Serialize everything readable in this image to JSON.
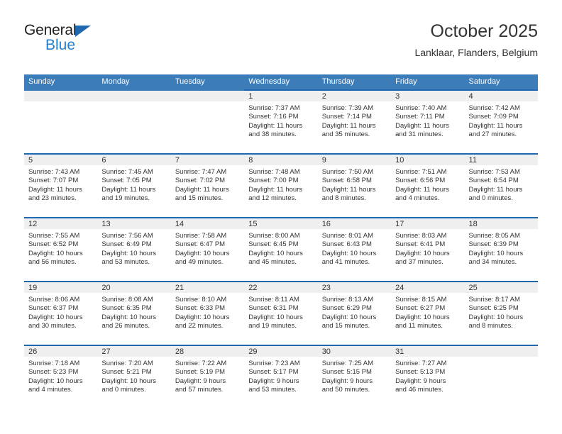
{
  "brand": {
    "name_top": "General",
    "name_bottom": "Blue",
    "accent_color": "#1f7fd0",
    "mark_color": "#1f67ae"
  },
  "header": {
    "title": "October 2025",
    "subtitle": "Lanklaar, Flanders, Belgium"
  },
  "calendar": {
    "header_bg": "#3c7cb8",
    "cell_top_border": "#1f67ae",
    "daynum_bg": "#efefef",
    "weekday_headers": [
      "Sunday",
      "Monday",
      "Tuesday",
      "Wednesday",
      "Thursday",
      "Friday",
      "Saturday"
    ],
    "weeks": [
      [
        {
          "day": "",
          "empty": true
        },
        {
          "day": "",
          "empty": true
        },
        {
          "day": "",
          "empty": true
        },
        {
          "day": "1",
          "sunrise": "Sunrise: 7:37 AM",
          "sunset": "Sunset: 7:16 PM",
          "daylight_1": "Daylight: 11 hours",
          "daylight_2": "and 38 minutes."
        },
        {
          "day": "2",
          "sunrise": "Sunrise: 7:39 AM",
          "sunset": "Sunset: 7:14 PM",
          "daylight_1": "Daylight: 11 hours",
          "daylight_2": "and 35 minutes."
        },
        {
          "day": "3",
          "sunrise": "Sunrise: 7:40 AM",
          "sunset": "Sunset: 7:11 PM",
          "daylight_1": "Daylight: 11 hours",
          "daylight_2": "and 31 minutes."
        },
        {
          "day": "4",
          "sunrise": "Sunrise: 7:42 AM",
          "sunset": "Sunset: 7:09 PM",
          "daylight_1": "Daylight: 11 hours",
          "daylight_2": "and 27 minutes."
        }
      ],
      [
        {
          "day": "5",
          "sunrise": "Sunrise: 7:43 AM",
          "sunset": "Sunset: 7:07 PM",
          "daylight_1": "Daylight: 11 hours",
          "daylight_2": "and 23 minutes."
        },
        {
          "day": "6",
          "sunrise": "Sunrise: 7:45 AM",
          "sunset": "Sunset: 7:05 PM",
          "daylight_1": "Daylight: 11 hours",
          "daylight_2": "and 19 minutes."
        },
        {
          "day": "7",
          "sunrise": "Sunrise: 7:47 AM",
          "sunset": "Sunset: 7:02 PM",
          "daylight_1": "Daylight: 11 hours",
          "daylight_2": "and 15 minutes."
        },
        {
          "day": "8",
          "sunrise": "Sunrise: 7:48 AM",
          "sunset": "Sunset: 7:00 PM",
          "daylight_1": "Daylight: 11 hours",
          "daylight_2": "and 12 minutes."
        },
        {
          "day": "9",
          "sunrise": "Sunrise: 7:50 AM",
          "sunset": "Sunset: 6:58 PM",
          "daylight_1": "Daylight: 11 hours",
          "daylight_2": "and 8 minutes."
        },
        {
          "day": "10",
          "sunrise": "Sunrise: 7:51 AM",
          "sunset": "Sunset: 6:56 PM",
          "daylight_1": "Daylight: 11 hours",
          "daylight_2": "and 4 minutes."
        },
        {
          "day": "11",
          "sunrise": "Sunrise: 7:53 AM",
          "sunset": "Sunset: 6:54 PM",
          "daylight_1": "Daylight: 11 hours",
          "daylight_2": "and 0 minutes."
        }
      ],
      [
        {
          "day": "12",
          "sunrise": "Sunrise: 7:55 AM",
          "sunset": "Sunset: 6:52 PM",
          "daylight_1": "Daylight: 10 hours",
          "daylight_2": "and 56 minutes."
        },
        {
          "day": "13",
          "sunrise": "Sunrise: 7:56 AM",
          "sunset": "Sunset: 6:49 PM",
          "daylight_1": "Daylight: 10 hours",
          "daylight_2": "and 53 minutes."
        },
        {
          "day": "14",
          "sunrise": "Sunrise: 7:58 AM",
          "sunset": "Sunset: 6:47 PM",
          "daylight_1": "Daylight: 10 hours",
          "daylight_2": "and 49 minutes."
        },
        {
          "day": "15",
          "sunrise": "Sunrise: 8:00 AM",
          "sunset": "Sunset: 6:45 PM",
          "daylight_1": "Daylight: 10 hours",
          "daylight_2": "and 45 minutes."
        },
        {
          "day": "16",
          "sunrise": "Sunrise: 8:01 AM",
          "sunset": "Sunset: 6:43 PM",
          "daylight_1": "Daylight: 10 hours",
          "daylight_2": "and 41 minutes."
        },
        {
          "day": "17",
          "sunrise": "Sunrise: 8:03 AM",
          "sunset": "Sunset: 6:41 PM",
          "daylight_1": "Daylight: 10 hours",
          "daylight_2": "and 37 minutes."
        },
        {
          "day": "18",
          "sunrise": "Sunrise: 8:05 AM",
          "sunset": "Sunset: 6:39 PM",
          "daylight_1": "Daylight: 10 hours",
          "daylight_2": "and 34 minutes."
        }
      ],
      [
        {
          "day": "19",
          "sunrise": "Sunrise: 8:06 AM",
          "sunset": "Sunset: 6:37 PM",
          "daylight_1": "Daylight: 10 hours",
          "daylight_2": "and 30 minutes."
        },
        {
          "day": "20",
          "sunrise": "Sunrise: 8:08 AM",
          "sunset": "Sunset: 6:35 PM",
          "daylight_1": "Daylight: 10 hours",
          "daylight_2": "and 26 minutes."
        },
        {
          "day": "21",
          "sunrise": "Sunrise: 8:10 AM",
          "sunset": "Sunset: 6:33 PM",
          "daylight_1": "Daylight: 10 hours",
          "daylight_2": "and 22 minutes."
        },
        {
          "day": "22",
          "sunrise": "Sunrise: 8:11 AM",
          "sunset": "Sunset: 6:31 PM",
          "daylight_1": "Daylight: 10 hours",
          "daylight_2": "and 19 minutes."
        },
        {
          "day": "23",
          "sunrise": "Sunrise: 8:13 AM",
          "sunset": "Sunset: 6:29 PM",
          "daylight_1": "Daylight: 10 hours",
          "daylight_2": "and 15 minutes."
        },
        {
          "day": "24",
          "sunrise": "Sunrise: 8:15 AM",
          "sunset": "Sunset: 6:27 PM",
          "daylight_1": "Daylight: 10 hours",
          "daylight_2": "and 11 minutes."
        },
        {
          "day": "25",
          "sunrise": "Sunrise: 8:17 AM",
          "sunset": "Sunset: 6:25 PM",
          "daylight_1": "Daylight: 10 hours",
          "daylight_2": "and 8 minutes."
        }
      ],
      [
        {
          "day": "26",
          "sunrise": "Sunrise: 7:18 AM",
          "sunset": "Sunset: 5:23 PM",
          "daylight_1": "Daylight: 10 hours",
          "daylight_2": "and 4 minutes."
        },
        {
          "day": "27",
          "sunrise": "Sunrise: 7:20 AM",
          "sunset": "Sunset: 5:21 PM",
          "daylight_1": "Daylight: 10 hours",
          "daylight_2": "and 0 minutes."
        },
        {
          "day": "28",
          "sunrise": "Sunrise: 7:22 AM",
          "sunset": "Sunset: 5:19 PM",
          "daylight_1": "Daylight: 9 hours",
          "daylight_2": "and 57 minutes."
        },
        {
          "day": "29",
          "sunrise": "Sunrise: 7:23 AM",
          "sunset": "Sunset: 5:17 PM",
          "daylight_1": "Daylight: 9 hours",
          "daylight_2": "and 53 minutes."
        },
        {
          "day": "30",
          "sunrise": "Sunrise: 7:25 AM",
          "sunset": "Sunset: 5:15 PM",
          "daylight_1": "Daylight: 9 hours",
          "daylight_2": "and 50 minutes."
        },
        {
          "day": "31",
          "sunrise": "Sunrise: 7:27 AM",
          "sunset": "Sunset: 5:13 PM",
          "daylight_1": "Daylight: 9 hours",
          "daylight_2": "and 46 minutes."
        },
        {
          "day": "",
          "empty": true
        }
      ]
    ]
  }
}
